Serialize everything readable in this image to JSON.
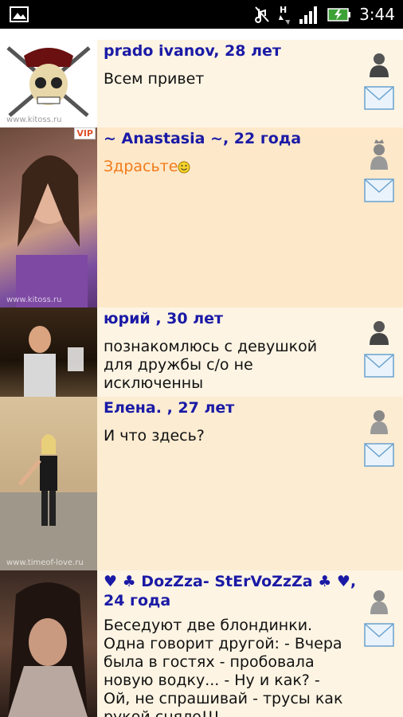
{
  "status_bar": {
    "time": "3:44",
    "icons": [
      "gallery-icon",
      "mute-icon",
      "data-transfer-icon",
      "signal-icon",
      "battery-icon"
    ]
  },
  "users": [
    {
      "name_line": "prado ivanov, 28 лет",
      "message": "Всем привет",
      "watermark": "www.kitoss.ru",
      "gender": "male"
    },
    {
      "name_line": "~ Anastasia ~, 22 года",
      "message": "Здрасьте",
      "vip": "VIP",
      "watermark": "www.kitoss.ru",
      "gender": "female-crown",
      "message_color": "#f27b1b"
    },
    {
      "name_line": "юрий , 30 лет",
      "message": "познакомлюсь с девушкой для дружбы с/о не исключенны",
      "gender": "male"
    },
    {
      "name_line": "Елена. , 27 лет",
      "message": "И что здесь?",
      "watermark": "www.timeof-love.ru",
      "gender": "female"
    },
    {
      "name_line": "♥ ♣ DozZza- StErVoZzZa ♣ ♥, 24 года",
      "message": "Беседуют две блондинки. Одна говорит другой: - Вчера была в гостях - пробовала новую водку... - Ну и как? - Ой, не спрашивай - трусы как рукой сняло!!!",
      "gender": "female"
    }
  ],
  "colors": {
    "name": "#1a1aa6",
    "row_a": "#fdf4e3",
    "row_vip": "#fde8c9"
  }
}
